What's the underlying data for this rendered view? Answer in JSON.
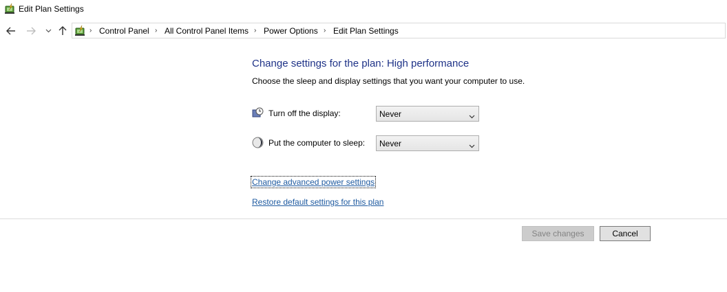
{
  "window": {
    "title": "Edit Plan Settings"
  },
  "nav": {
    "back_icon": "back-arrow-icon",
    "forward_icon": "forward-arrow-icon",
    "recent_icon": "chevron-down-icon",
    "up_icon": "up-arrow-icon"
  },
  "breadcrumb": [
    "Control Panel",
    "All Control Panel Items",
    "Power Options",
    "Edit Plan Settings"
  ],
  "main": {
    "heading": "Change settings for the plan: High performance",
    "subtext": "Choose the sleep and display settings that you want your computer to use.",
    "settings": [
      {
        "label": "Turn off the display:",
        "value": "Never",
        "icon": "display-clock-icon"
      },
      {
        "label": "Put the computer to sleep:",
        "value": "Never",
        "icon": "moon-icon"
      }
    ],
    "links": {
      "advanced": "Change advanced power settings",
      "restore": "Restore default settings for this plan"
    }
  },
  "buttons": {
    "save": "Save changes",
    "cancel": "Cancel"
  },
  "colors": {
    "heading": "#1e3287",
    "link": "#1e5aa0"
  }
}
